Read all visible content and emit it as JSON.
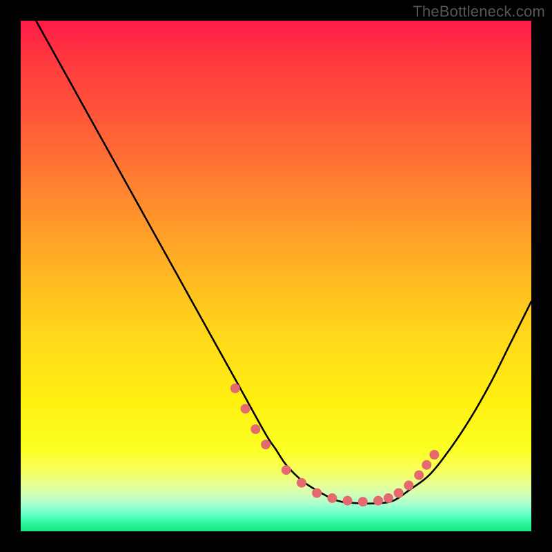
{
  "watermark": "TheBottleneck.com",
  "chart_data": {
    "type": "line",
    "title": "",
    "xlabel": "",
    "ylabel": "",
    "xlim": [
      0,
      100
    ],
    "ylim": [
      0,
      100
    ],
    "grid": false,
    "series": [
      {
        "name": "curve",
        "x": [
          3,
          8,
          13,
          18,
          23,
          28,
          33,
          38,
          43,
          48,
          50,
          52,
          55,
          58,
          62,
          66,
          70,
          73,
          76,
          80,
          84,
          88,
          92,
          96,
          100
        ],
        "y": [
          100,
          91,
          82,
          73,
          64,
          55,
          46,
          37,
          28,
          19,
          16,
          13,
          10,
          8,
          6,
          5.5,
          5.5,
          6,
          8,
          11,
          16,
          22,
          29,
          37,
          45
        ]
      }
    ],
    "markers": {
      "name": "highlight-dots",
      "x": [
        42,
        44,
        46,
        48,
        52,
        55,
        58,
        61,
        64,
        67,
        70,
        72,
        74,
        76,
        78,
        79.5,
        81
      ],
      "y": [
        28,
        24,
        20,
        17,
        12,
        9.5,
        7.5,
        6.5,
        6,
        5.8,
        6,
        6.5,
        7.5,
        9,
        11,
        13,
        15
      ]
    },
    "marker_color": "#e46a6f",
    "marker_radius": 7,
    "gradient_stops": [
      {
        "pct": 0,
        "color": "#ff1a47"
      },
      {
        "pct": 50,
        "color": "#ffb822"
      },
      {
        "pct": 84,
        "color": "#fcff22"
      },
      {
        "pct": 100,
        "color": "#16e686"
      }
    ]
  }
}
